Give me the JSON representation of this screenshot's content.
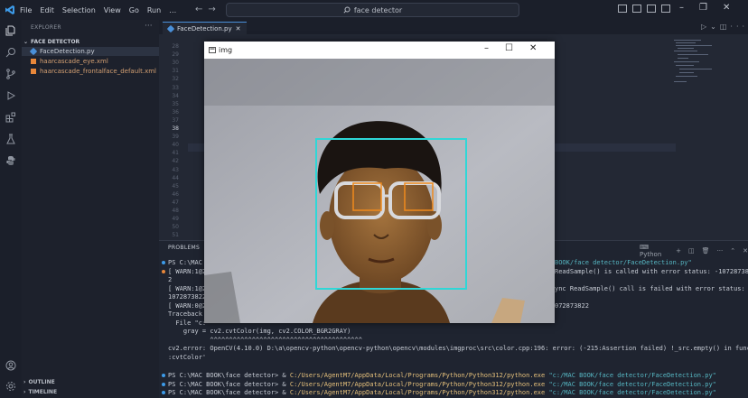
{
  "menu": [
    "File",
    "Edit",
    "Selection",
    "View",
    "Go",
    "Run",
    "…"
  ],
  "command_center": "face detector",
  "explorer": {
    "title": "EXPLORER",
    "folder": "FACE DETECTOR",
    "files": [
      {
        "name": "FaceDetection.py",
        "type": "py"
      },
      {
        "name": "haarcascade_eye.xml",
        "type": "xml"
      },
      {
        "name": "haarcascade_frontalface_default.xml",
        "type": "xml"
      }
    ],
    "outline": "OUTLINE",
    "timeline": "TIMELINE"
  },
  "tab": {
    "label": "FaceDetection.py"
  },
  "line_numbers": [
    "28",
    "29",
    "30",
    "31",
    "32",
    "33",
    "34",
    "35",
    "36",
    "37",
    "38",
    "39",
    "40",
    "41",
    "42",
    "43",
    "44",
    "45",
    "46",
    "47",
    "48",
    "49",
    "50",
    "51",
    "52"
  ],
  "current_line": "38",
  "panel": {
    "tab": "PROBLEMS",
    "shell": "Python"
  },
  "terminal_lines": [
    {
      "text": "PS C:\\MAC",
      "right": "BOOK/face detector/FaceDetection.py\""
    },
    {
      "text": "[ WARN:1@2",
      "right": "ReadSample() is called with error status: -107287382"
    },
    {
      "text": "2",
      "right": ""
    },
    {
      "text": "[ WARN:1@2",
      "right": "ync ReadSample() call is failed with error status: -"
    },
    {
      "text": "1072873822",
      "right": ""
    },
    {
      "text": "[ WARN:0@2",
      "right": "072873822"
    },
    {
      "text": "Traceback",
      "right": ""
    },
    {
      "text": "  File \"c:",
      "right": ""
    },
    {
      "text": "    gray = cv2.cvtColor(img, cv2.COLOR_BGR2GRAY)",
      "right": ""
    },
    {
      "text": "           ^^^^^^^^^^^^^^^^^^^^^^^^^^^^^^^^^^^^^^^^",
      "right": ""
    },
    {
      "text": "cv2.error: OpenCV(4.10.0) D:\\a\\opencv-python\\opencv-python\\opencv\\modules\\imgproc\\src\\color.cpp:196: error: (-215:Assertion failed) !_src.empty() in function 'cv:",
      "right": ""
    },
    {
      "text": ":cvtColor'",
      "right": ""
    }
  ],
  "prompt_lines": [
    {
      "prompt": "PS C:\\MAC BOOK\\face detector> & ",
      "exe": "C:/Users/AgentM7/AppData/Local/Programs/Python/Python312/python.exe",
      "arg": " \"c:/MAC BOOK/face detector/FaceDetection.py\""
    },
    {
      "prompt": "PS C:\\MAC BOOK\\face detector> & ",
      "exe": "C:/Users/AgentM7/AppData/Local/Programs/Python/Python312/python.exe",
      "arg": " \"c:/MAC BOOK/face detector/FaceDetection.py\""
    },
    {
      "prompt": "PS C:\\MAC BOOK\\face detector> & ",
      "exe": "C:/Users/AgentM7/AppData/Local/Programs/Python/Python312/python.exe",
      "arg": " \"c:/MAC BOOK/face detector/FaceDetection.py\""
    }
  ],
  "cv_window": {
    "title": "img",
    "face_box_color": "#2fd7d7",
    "eye_box_color": "#f08a1c"
  },
  "colors": {
    "accent": "#4a90d9",
    "xml": "#e8873a"
  }
}
